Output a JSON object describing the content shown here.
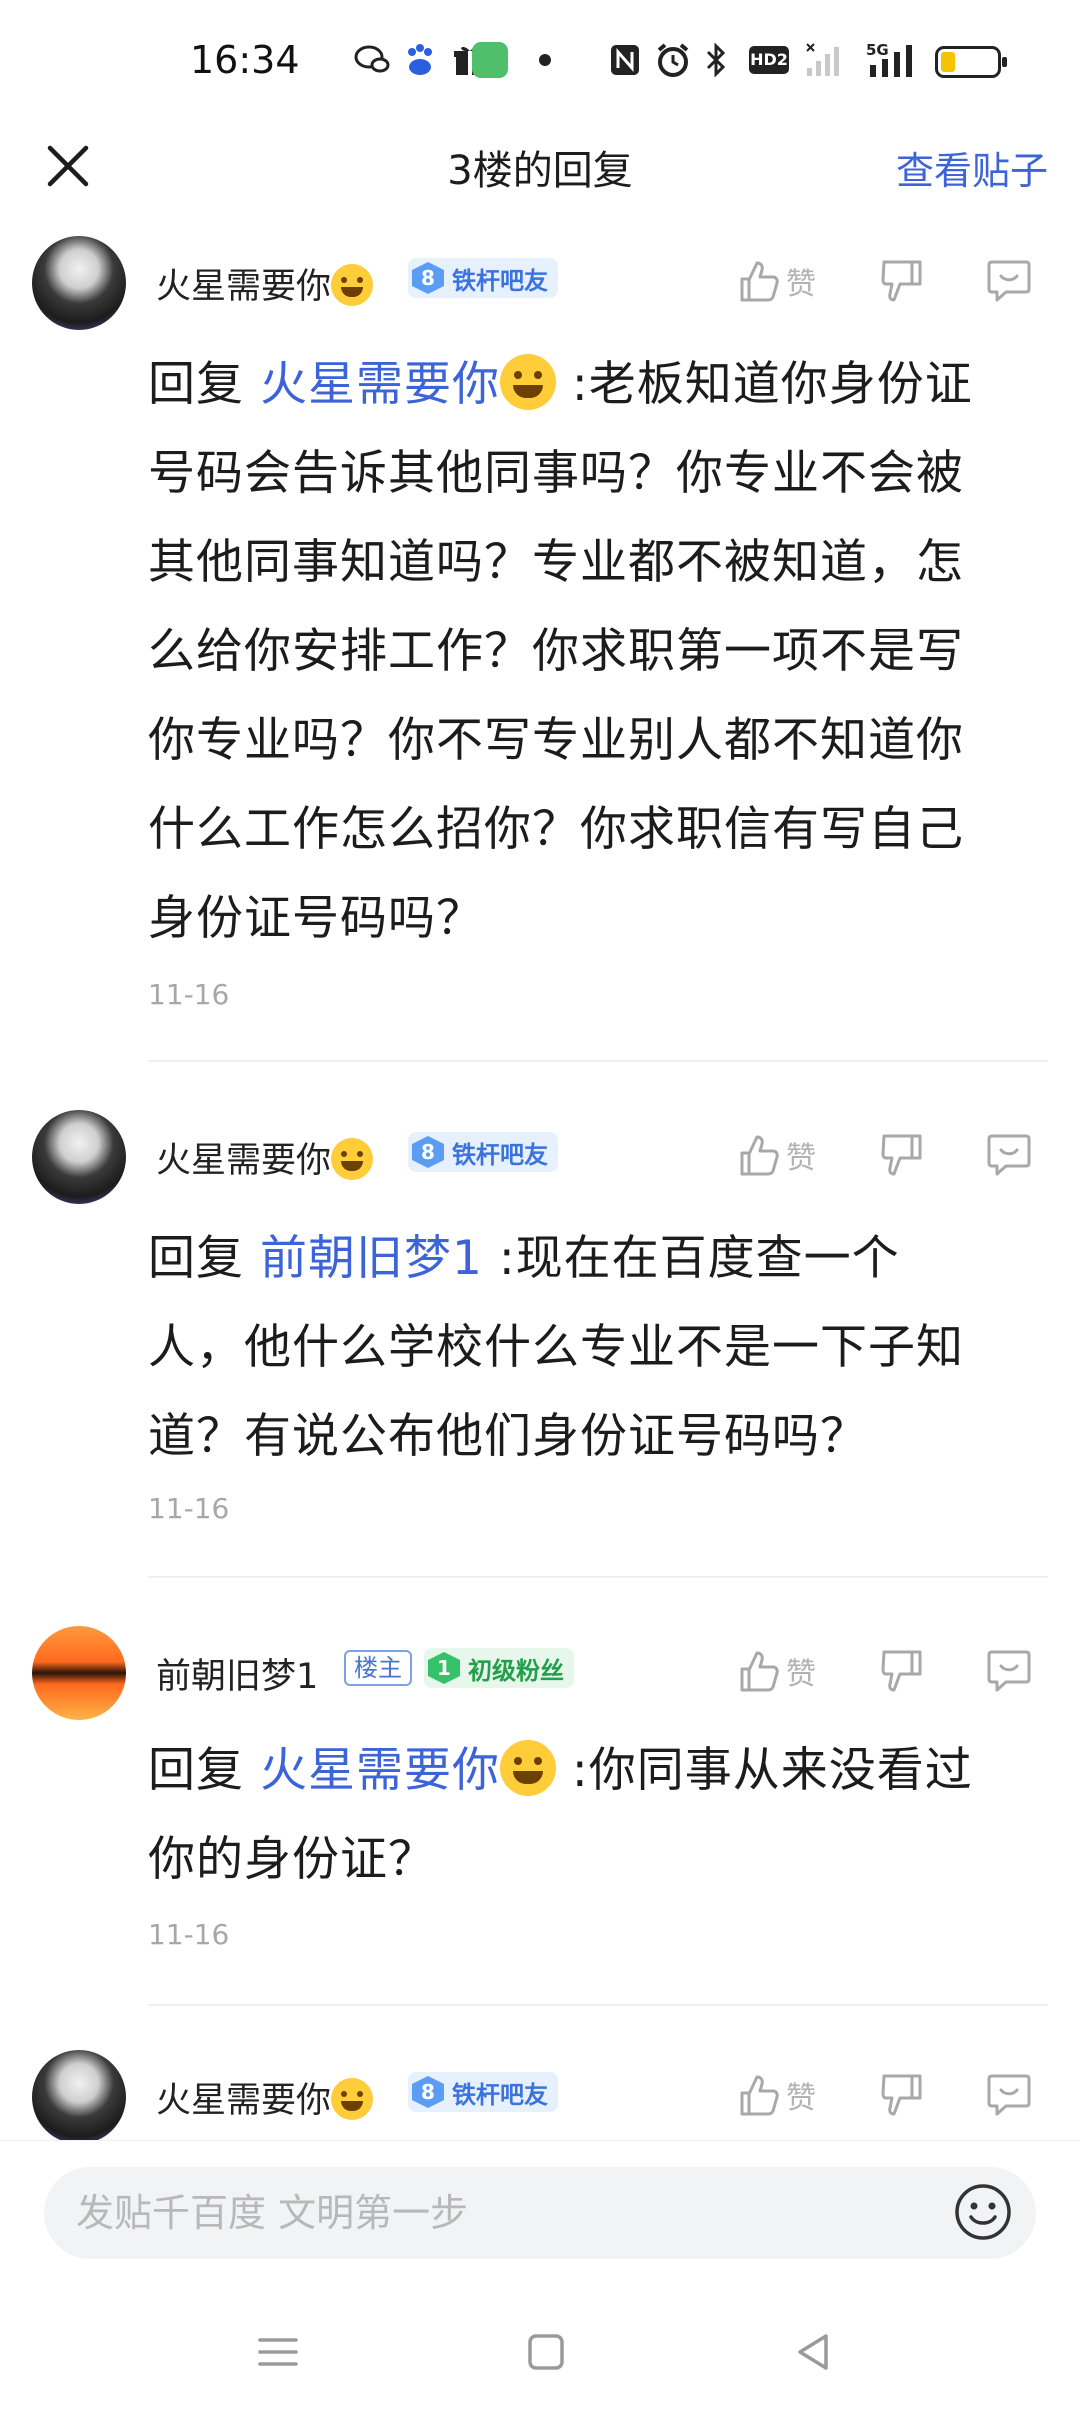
{
  "status_bar": {
    "time": "16:34",
    "icons": [
      "wechat-icon",
      "baidu-icon",
      "gift-icon",
      "call-icon",
      "dot-icon",
      "nfc-icon",
      "alarm-icon",
      "bluetooth-icon",
      "hd-icon",
      "signal-icon",
      "signal-5g-icon",
      "battery-icon"
    ],
    "hd_label": "HD2",
    "network_label": "5G"
  },
  "header": {
    "title": "3楼的回复",
    "view_post_label": "查看贴子"
  },
  "replies": [
    {
      "username": "火星需要你",
      "level": "8",
      "badge": "铁杆吧友",
      "like_label": "赞",
      "reply_prefix": "回复",
      "reply_target": "火星需要你",
      "lines": [
        ":老板知道你身份证",
        "号码会告诉其他同事吗？你专业不会被",
        "其他同事知道吗？专业都不被知道，怎",
        "么给你安排工作？你求职第一项不是写",
        "你专业吗？你不写专业别人都不知道你",
        "什么工作怎么招你？你求职信有写自己",
        "身份证号码吗？"
      ],
      "date": "11-16"
    },
    {
      "username": "火星需要你",
      "level": "8",
      "badge": "铁杆吧友",
      "like_label": "赞",
      "reply_prefix": "回复",
      "reply_target": "前朝旧梦1",
      "lines": [
        ":现在在百度查一个",
        "人，他什么学校什么专业不是一下子知",
        "道？有说公布他们身份证号码吗？"
      ],
      "date": "11-16"
    },
    {
      "username": "前朝旧梦1",
      "host_tag": "楼主",
      "level": "1",
      "badge": "初级粉丝",
      "like_label": "赞",
      "reply_prefix": "回复",
      "reply_target": "火星需要你",
      "lines": [
        ":你同事从来没看过",
        "你的身份证？"
      ],
      "date": "11-16"
    },
    {
      "username": "火星需要你",
      "level": "8",
      "badge": "铁杆吧友",
      "like_label": "赞"
    }
  ],
  "input": {
    "placeholder": "发贴千百度 文明第一步"
  },
  "colors": {
    "accent_blue": "#3c64d8",
    "badge_blue": "#5b9df5",
    "badge_green": "#36c26a"
  }
}
